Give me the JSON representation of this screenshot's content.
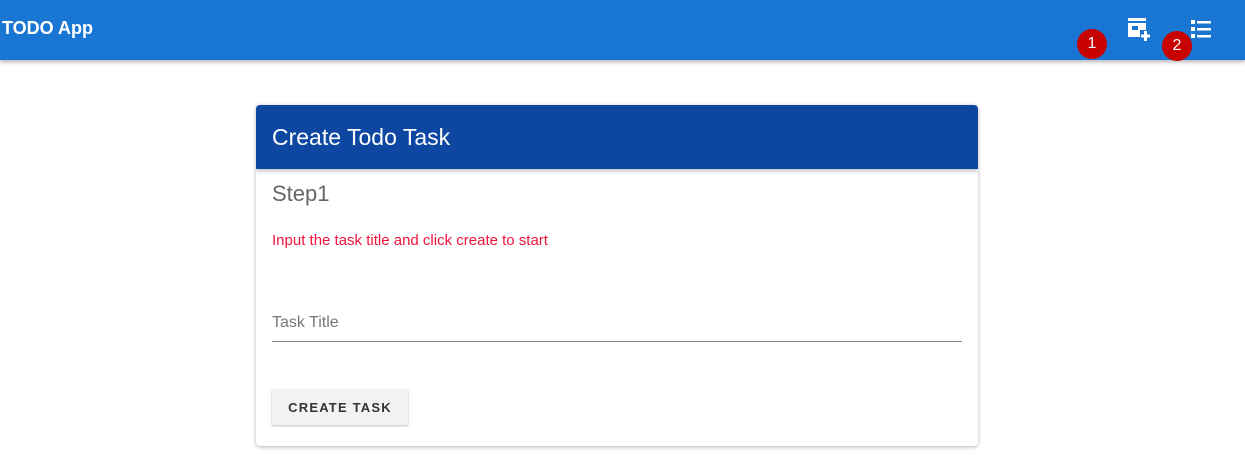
{
  "appbar": {
    "title": "TODO App",
    "color": "#1976d2",
    "actions": [
      {
        "icon": "add-task-icon",
        "badge": "1"
      },
      {
        "icon": "list-icon",
        "badge": "2"
      }
    ]
  },
  "card": {
    "title": "Create Todo Task",
    "header_color": "#0d47a1",
    "step": "Step1",
    "hint": "Input the task title and click create to start",
    "task_title_placeholder": "Task Title",
    "task_title_value": "",
    "create_label": "CREATE TASK"
  }
}
